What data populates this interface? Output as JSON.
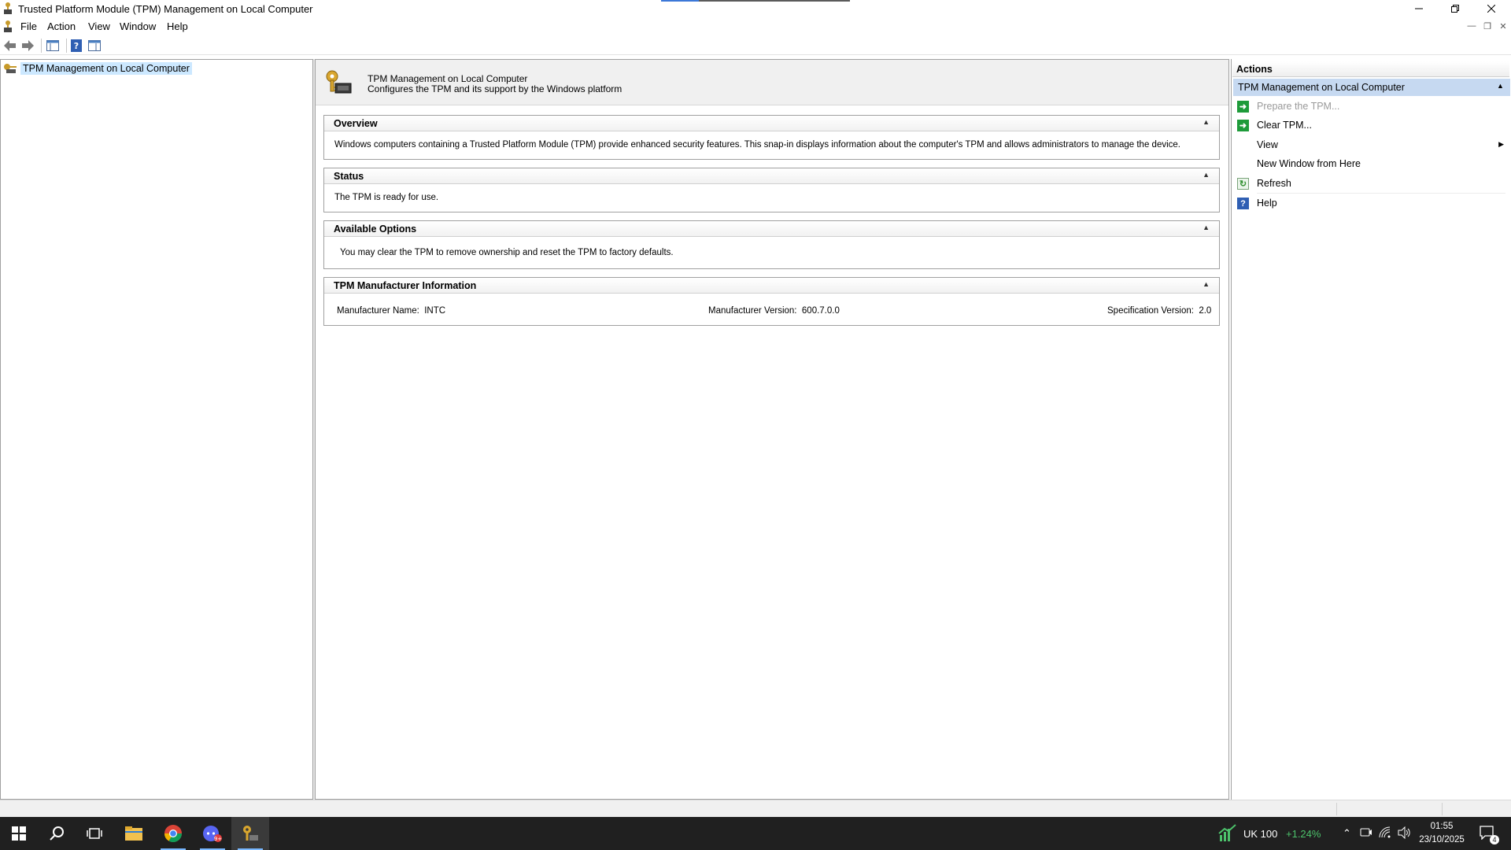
{
  "window": {
    "title": "Trusted Platform Module (TPM) Management on Local Computer"
  },
  "menu": {
    "items": [
      "File",
      "Action",
      "View",
      "Window",
      "Help"
    ]
  },
  "tree": {
    "item": "TPM Management on Local Computer"
  },
  "center": {
    "header_title": "TPM Management on Local Computer",
    "header_subtitle": "Configures the TPM and its support by the Windows platform",
    "overview": {
      "title": "Overview",
      "text": "Windows computers containing a Trusted Platform Module (TPM) provide enhanced security features. This snap-in displays information about the computer's TPM and allows administrators to manage the device."
    },
    "status": {
      "title": "Status",
      "text": "The TPM is ready for use."
    },
    "options": {
      "title": "Available Options",
      "text": "You may clear the TPM to remove ownership and reset the TPM to factory defaults."
    },
    "manufacturer": {
      "title": "TPM Manufacturer Information",
      "name_label": "Manufacturer Name:",
      "name_value": "INTC",
      "version_label": "Manufacturer Version:",
      "version_value": "600.7.0.0",
      "spec_label": "Specification Version:",
      "spec_value": "2.0"
    }
  },
  "actions": {
    "title": "Actions",
    "group": "TPM Management on Local Computer",
    "items": [
      {
        "label": "Prepare the TPM...",
        "icon": "green-arrow-icon",
        "disabled": true
      },
      {
        "label": "Clear TPM...",
        "icon": "green-arrow-icon",
        "disabled": false
      },
      {
        "label": "View",
        "icon": "",
        "submenu": true
      },
      {
        "label": "New Window from Here",
        "icon": ""
      },
      {
        "label": "Refresh",
        "icon": "refresh-icon"
      },
      {
        "label": "Help",
        "icon": "help-icon"
      }
    ]
  },
  "taskbar": {
    "apps": [
      "start-icon",
      "search-icon",
      "task-view-icon",
      "file-explorer-icon",
      "chrome-icon",
      "discord-icon",
      "tpm-snapin-icon"
    ],
    "ticker_name": "UK 100",
    "ticker_change": "+1.24%",
    "time": "01:55",
    "date": "23/10/2025",
    "notification_count": "4",
    "colors": {
      "ticker_positive": "#4cc26b",
      "taskbar_bg": "#202020"
    }
  }
}
